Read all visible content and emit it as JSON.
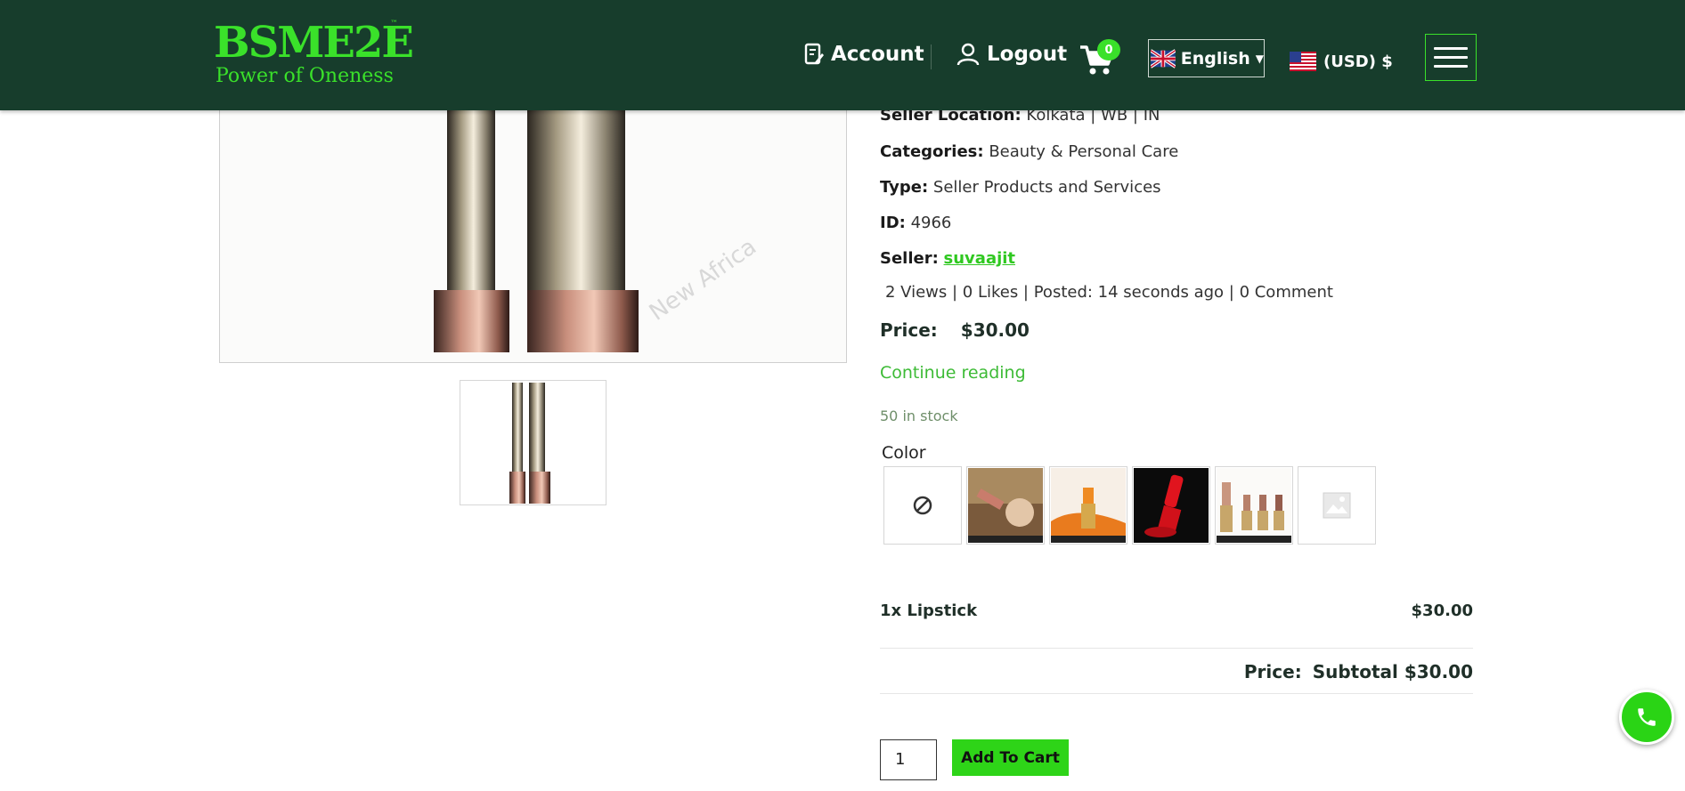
{
  "header": {
    "logo_main": "BSME2E",
    "logo_tm": "™",
    "logo_sub": "Power of Oneness",
    "account_label": "Account",
    "logout_label": "Logout",
    "cart_count": "0",
    "language": "English",
    "currency": "(USD) $",
    "colors": {
      "background": "#173d2c",
      "accent": "#3ae12a"
    }
  },
  "product": {
    "seller_location_label": "Seller Location:",
    "seller_location": "Kolkata | WB | IN",
    "categories_label": "Categories:",
    "categories": "Beauty & Personal Care",
    "type_label": "Type:",
    "type": "Seller Products and Services",
    "id_label": "ID:",
    "id": "4966",
    "seller_label": "Seller:",
    "seller": "suvaajit",
    "stats": "2 Views |  0 Likes |  Posted: 14 seconds ago |  0 Comment",
    "price_label": "Price:",
    "price": "$30.00",
    "continue_reading": "Continue reading",
    "stock": "50 in stock",
    "color_label": "Color",
    "swatches": [
      {
        "name": "none-swatch",
        "icon": "no-selection-icon"
      },
      {
        "name": "swatch-lipstick-gold",
        "icon": "lipstick-gold-image"
      },
      {
        "name": "swatch-lipstick-orange",
        "icon": "lipstick-orange-image"
      },
      {
        "name": "swatch-lipstick-red",
        "icon": "lipstick-red-image"
      },
      {
        "name": "swatch-lipstick-nude",
        "icon": "lipstick-nude-image"
      },
      {
        "name": "swatch-placeholder",
        "icon": "image-placeholder-icon"
      }
    ]
  },
  "order": {
    "line_item": "1x Lipstick",
    "line_price": "$30.00",
    "price_label": "Price:",
    "subtotal": "Subtotal $30.00",
    "quantity": "1",
    "add_to_cart": "Add To Cart"
  }
}
